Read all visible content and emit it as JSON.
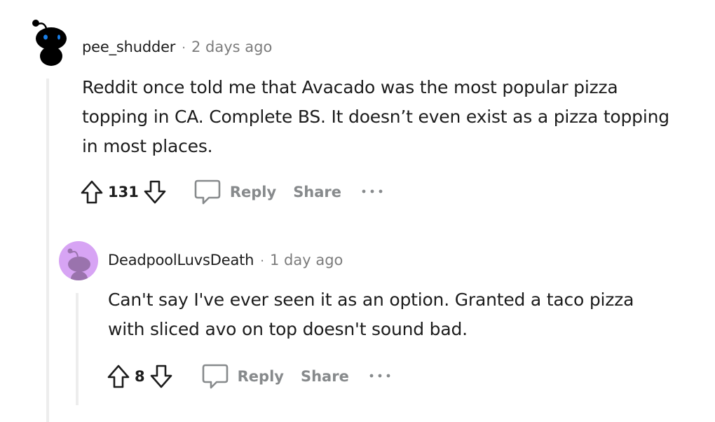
{
  "comments": [
    {
      "username": "pee_shudder",
      "separator": "·",
      "time": "2 days ago",
      "text": "Reddit once told me that Avacado was the most popular pizza topping in CA. Complete BS. It doesn’t even exist as a pizza topping in most places.",
      "score": "131",
      "reply_label": "Reply",
      "share_label": "Share",
      "avatar_bg": "#ffffff"
    },
    {
      "username": "DeadpoolLuvsDeath",
      "separator": "·",
      "time": "1 day ago",
      "text": "Can't say I've ever seen it as an option. Granted a taco pizza with sliced avo on top doesn't sound bad.",
      "score": "8",
      "reply_label": "Reply",
      "share_label": "Share",
      "avatar_bg": "#d7a4f4"
    }
  ],
  "icons": {
    "upvote": "arrow-up-outline",
    "downvote": "arrow-down-outline",
    "reply": "speech-bubble-outline",
    "more": "horizontal-ellipsis"
  },
  "colors": {
    "meta_gray": "#7c7c7c",
    "action_gray": "#878a8c",
    "thread_line": "#ededed"
  }
}
